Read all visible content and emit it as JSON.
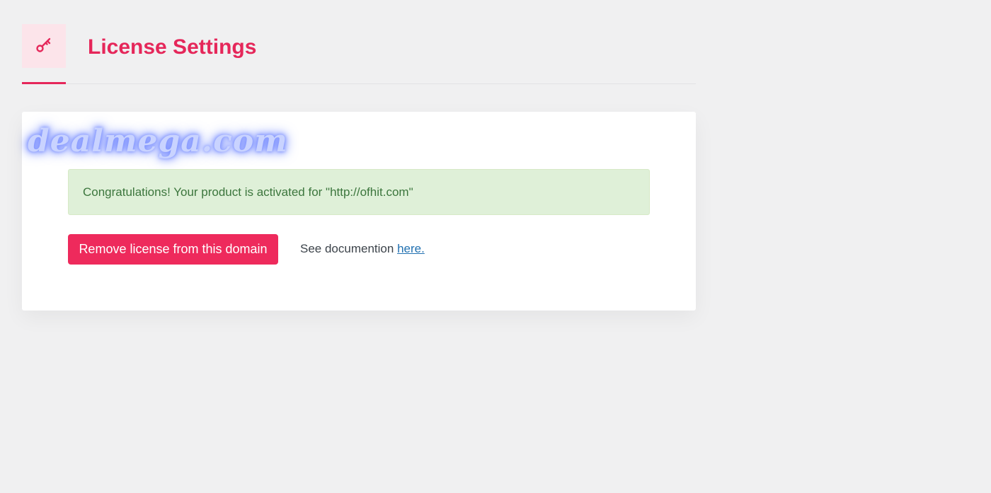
{
  "header": {
    "icon": "key-icon",
    "title": "License Settings"
  },
  "watermark": "dealmega.com",
  "alert": {
    "message": "Congratulations! Your product is activated for \"http://ofhit.com\""
  },
  "actions": {
    "remove_label": "Remove license from this domain",
    "doc_prefix": "See documention",
    "doc_link": "here."
  },
  "colors": {
    "accent": "#e5275a",
    "button": "#ee2a5c",
    "success_bg": "#dff0d8",
    "success_text": "#3c763d",
    "link": "#2271b1"
  }
}
